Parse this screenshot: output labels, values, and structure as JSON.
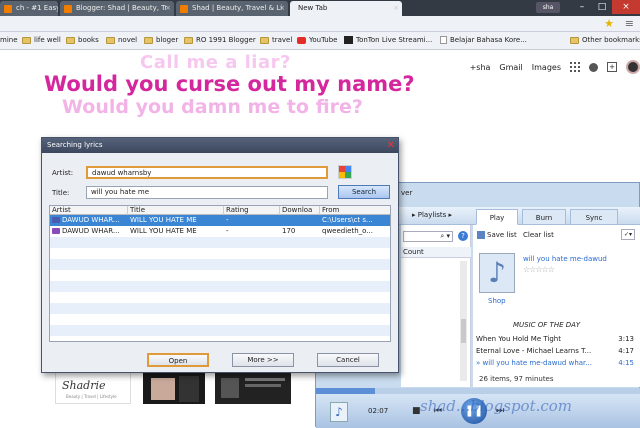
{
  "browser": {
    "tabs": [
      {
        "label": "ch - #1 Easy &",
        "active": false
      },
      {
        "label": "Blogger: Shad | Beauty, Tr",
        "active": false
      },
      {
        "label": "Shad | Beauty, Travel & Li",
        "active": false
      },
      {
        "label": "New Tab",
        "active": true
      }
    ],
    "profile": "sha",
    "bookmarks": [
      {
        "label": "mine",
        "icon": "page-icon"
      },
      {
        "label": "life well",
        "icon": "folder-icon"
      },
      {
        "label": "books",
        "icon": "folder-icon"
      },
      {
        "label": "novel",
        "icon": "folder-icon"
      },
      {
        "label": "bloger",
        "icon": "folder-icon"
      },
      {
        "label": "RO 1991 Blogger",
        "icon": "folder-icon"
      },
      {
        "label": "travel",
        "icon": "folder-icon"
      },
      {
        "label": "YouTube",
        "icon": "youtube-icon"
      },
      {
        "label": "TonTon Live Streami...",
        "icon": "tonton-icon"
      },
      {
        "label": "Belajar Bahasa Kore...",
        "icon": "page-icon"
      },
      {
        "label": "Other bookmarks",
        "icon": "folder-icon"
      }
    ],
    "topLinks": {
      "user": "+sha",
      "gmail": "Gmail",
      "images": "Images"
    }
  },
  "overlayLyrics": [
    "Call me a liar?",
    "Would you curse out my name?",
    "Would you damn me to fire?"
  ],
  "dialog": {
    "title": "Searching lyrics",
    "artistLabel": "Artist:",
    "artistValue": "dawud wharnsby",
    "titleLabel": "Title:",
    "titleValue": "will you hate me",
    "searchButton": "Search",
    "columns": [
      "Artist",
      "Title",
      "Rating",
      "Downloa",
      "From"
    ],
    "rows": [
      {
        "artist": "DAWUD WHAR...",
        "title": "WILL YOU HATE ME",
        "rating": "-",
        "downloads": "",
        "from": "C:\\Users\\ct s...",
        "selected": true
      },
      {
        "artist": "DAWUD WHAR...",
        "title": "WILL YOU HATE ME",
        "rating": "-",
        "downloads": "170",
        "from": "qweedieth_o...",
        "selected": false
      }
    ],
    "openButton": "Open",
    "moreButton": "More >>",
    "cancelButton": "Cancel"
  },
  "mediaPlayer": {
    "titleFragment": "ver",
    "playlistsCrumb": "Playlists",
    "tabs": [
      "Play",
      "Burn",
      "Sync"
    ],
    "countHeader": "Count",
    "saveList": "Save list",
    "clearList": "Clear list",
    "nowPlaying": "will you hate me-dawud",
    "shop": "Shop",
    "musicOfTheDay": "MUSIC OF THE DAY",
    "playlist": [
      {
        "title": "When You Hold Me Tight",
        "duration": "3:13",
        "current": false
      },
      {
        "title": "Eternal Love - Michael Learns T...",
        "duration": "4:17",
        "current": false
      },
      {
        "title": "will you hate me-dawud whar...",
        "duration": "4:15",
        "current": true
      }
    ],
    "itemsInfo": "26 items, 97 minutes",
    "elapsed": "02:07",
    "progress": 0.18
  },
  "watermark": "shad...blogspot.com",
  "colors": {
    "accentOrange": "#e09a3a",
    "selectedRow": "#3a86d4",
    "lyricPink": "#d4279e"
  }
}
